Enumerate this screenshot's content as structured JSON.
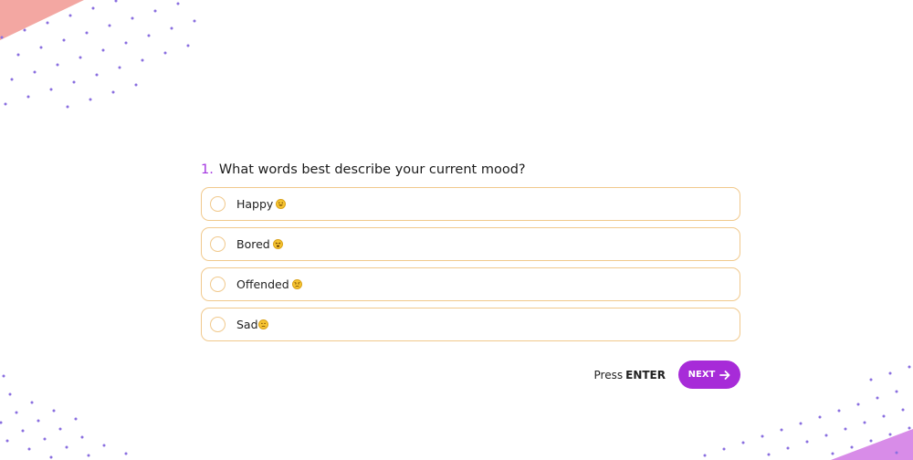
{
  "question": {
    "number": "1.",
    "text": "What words best describe your current mood?"
  },
  "options": [
    {
      "label": "Happy",
      "emoji": "grinning-face-emoji"
    },
    {
      "label": "Bored",
      "emoji": "tired-face-emoji"
    },
    {
      "label": "Offended",
      "emoji": "angry-face-emoji"
    },
    {
      "label": "Sad",
      "emoji": "slightly-frowning-face-emoji"
    }
  ],
  "footer": {
    "press_text": "Press",
    "press_key": "ENTER",
    "next_label": "NEXT",
    "next_icon": "arrow-right-icon"
  },
  "theme": {
    "accent": "#a72bd8",
    "number_color": "#a335e0",
    "option_border": "#f1c98c",
    "triangle_top": "#f3a7a2",
    "triangle_bottom": "#d88ce8",
    "dot_color": "#8a6fe0"
  }
}
